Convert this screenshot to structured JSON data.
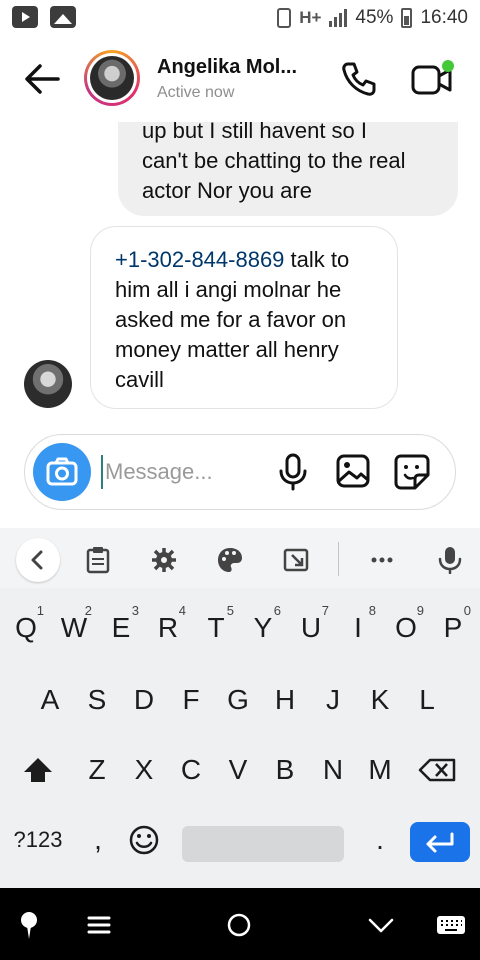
{
  "status_bar": {
    "battery": "45%",
    "time": "16:40",
    "network": "H+",
    "left_icons": [
      "youtube-icon",
      "gallery-notification-icon"
    ],
    "right_icons": [
      "vibrate-icon",
      "signal-icon",
      "battery-icon"
    ]
  },
  "header": {
    "contact_name": "Angelika Mol...",
    "status": "Active now",
    "icons": [
      "back-arrow-icon",
      "phone-icon",
      "video-icon"
    ],
    "online_color": "#44c83a"
  },
  "messages": [
    {
      "direction": "outgoing",
      "lines": [
        "up but I still havent so I",
        "can't be chatting to the real",
        "actor Nor you are"
      ]
    },
    {
      "direction": "incoming",
      "phone": "+1-302-844-8869",
      "lines_after_phone": [
        " talk to",
        "him all  i angi molnar he",
        "asked me for a favor on",
        "money matter all henry",
        "cavill"
      ]
    }
  ],
  "composer": {
    "placeholder": "Message...",
    "icons": [
      "camera-icon",
      "mic-icon",
      "gallery-icon",
      "sticker-icon"
    ],
    "accent": "#3897f0"
  },
  "keyboard": {
    "toolbar_icons": [
      "chevron-left-icon",
      "clipboard-icon",
      "settings-icon",
      "palette-icon",
      "resize-icon",
      "more-icon",
      "voice-icon"
    ],
    "row1": [
      {
        "key": "Q",
        "hint": "1"
      },
      {
        "key": "W",
        "hint": "2"
      },
      {
        "key": "E",
        "hint": "3"
      },
      {
        "key": "R",
        "hint": "4"
      },
      {
        "key": "T",
        "hint": "5"
      },
      {
        "key": "Y",
        "hint": "6"
      },
      {
        "key": "U",
        "hint": "7"
      },
      {
        "key": "I",
        "hint": "8"
      },
      {
        "key": "O",
        "hint": "9"
      },
      {
        "key": "P",
        "hint": "0"
      }
    ],
    "row2": [
      "A",
      "S",
      "D",
      "F",
      "G",
      "H",
      "J",
      "K",
      "L"
    ],
    "row3": [
      "Z",
      "X",
      "C",
      "V",
      "B",
      "N",
      "M"
    ],
    "symbols_key": "?123",
    "comma": ",",
    "period": ".",
    "enter_color": "#1a73e8"
  },
  "nav_bar": {
    "icons": [
      "pin-icon",
      "menu-icon",
      "home-icon",
      "back-down-icon",
      "keyboard-icon"
    ]
  }
}
